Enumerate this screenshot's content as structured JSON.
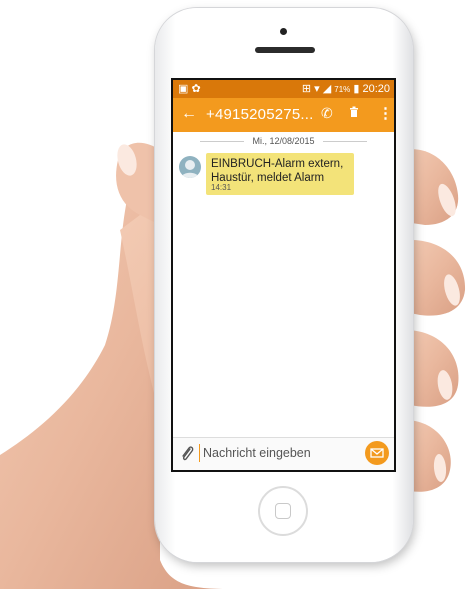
{
  "status_bar": {
    "battery": "71%",
    "time": "20:20"
  },
  "app_bar": {
    "back_icon": "arrow-left",
    "phone_number": "+4915205275...",
    "call_icon": "phone",
    "delete_icon": "trash",
    "menu_icon": "more-vertical"
  },
  "conversation": {
    "date": "Mi., 12/08/2015",
    "message": {
      "text": "EINBRUCH-Alarm extern, Haustür, meldet Alarm",
      "time": "14:31"
    }
  },
  "input": {
    "placeholder": "Nachricht eingeben",
    "attach_icon": "paperclip",
    "send_icon": "envelope"
  },
  "colors": {
    "status_bar": "#d9780a",
    "app_bar": "#f39a1e",
    "bubble": "#f3e379"
  }
}
